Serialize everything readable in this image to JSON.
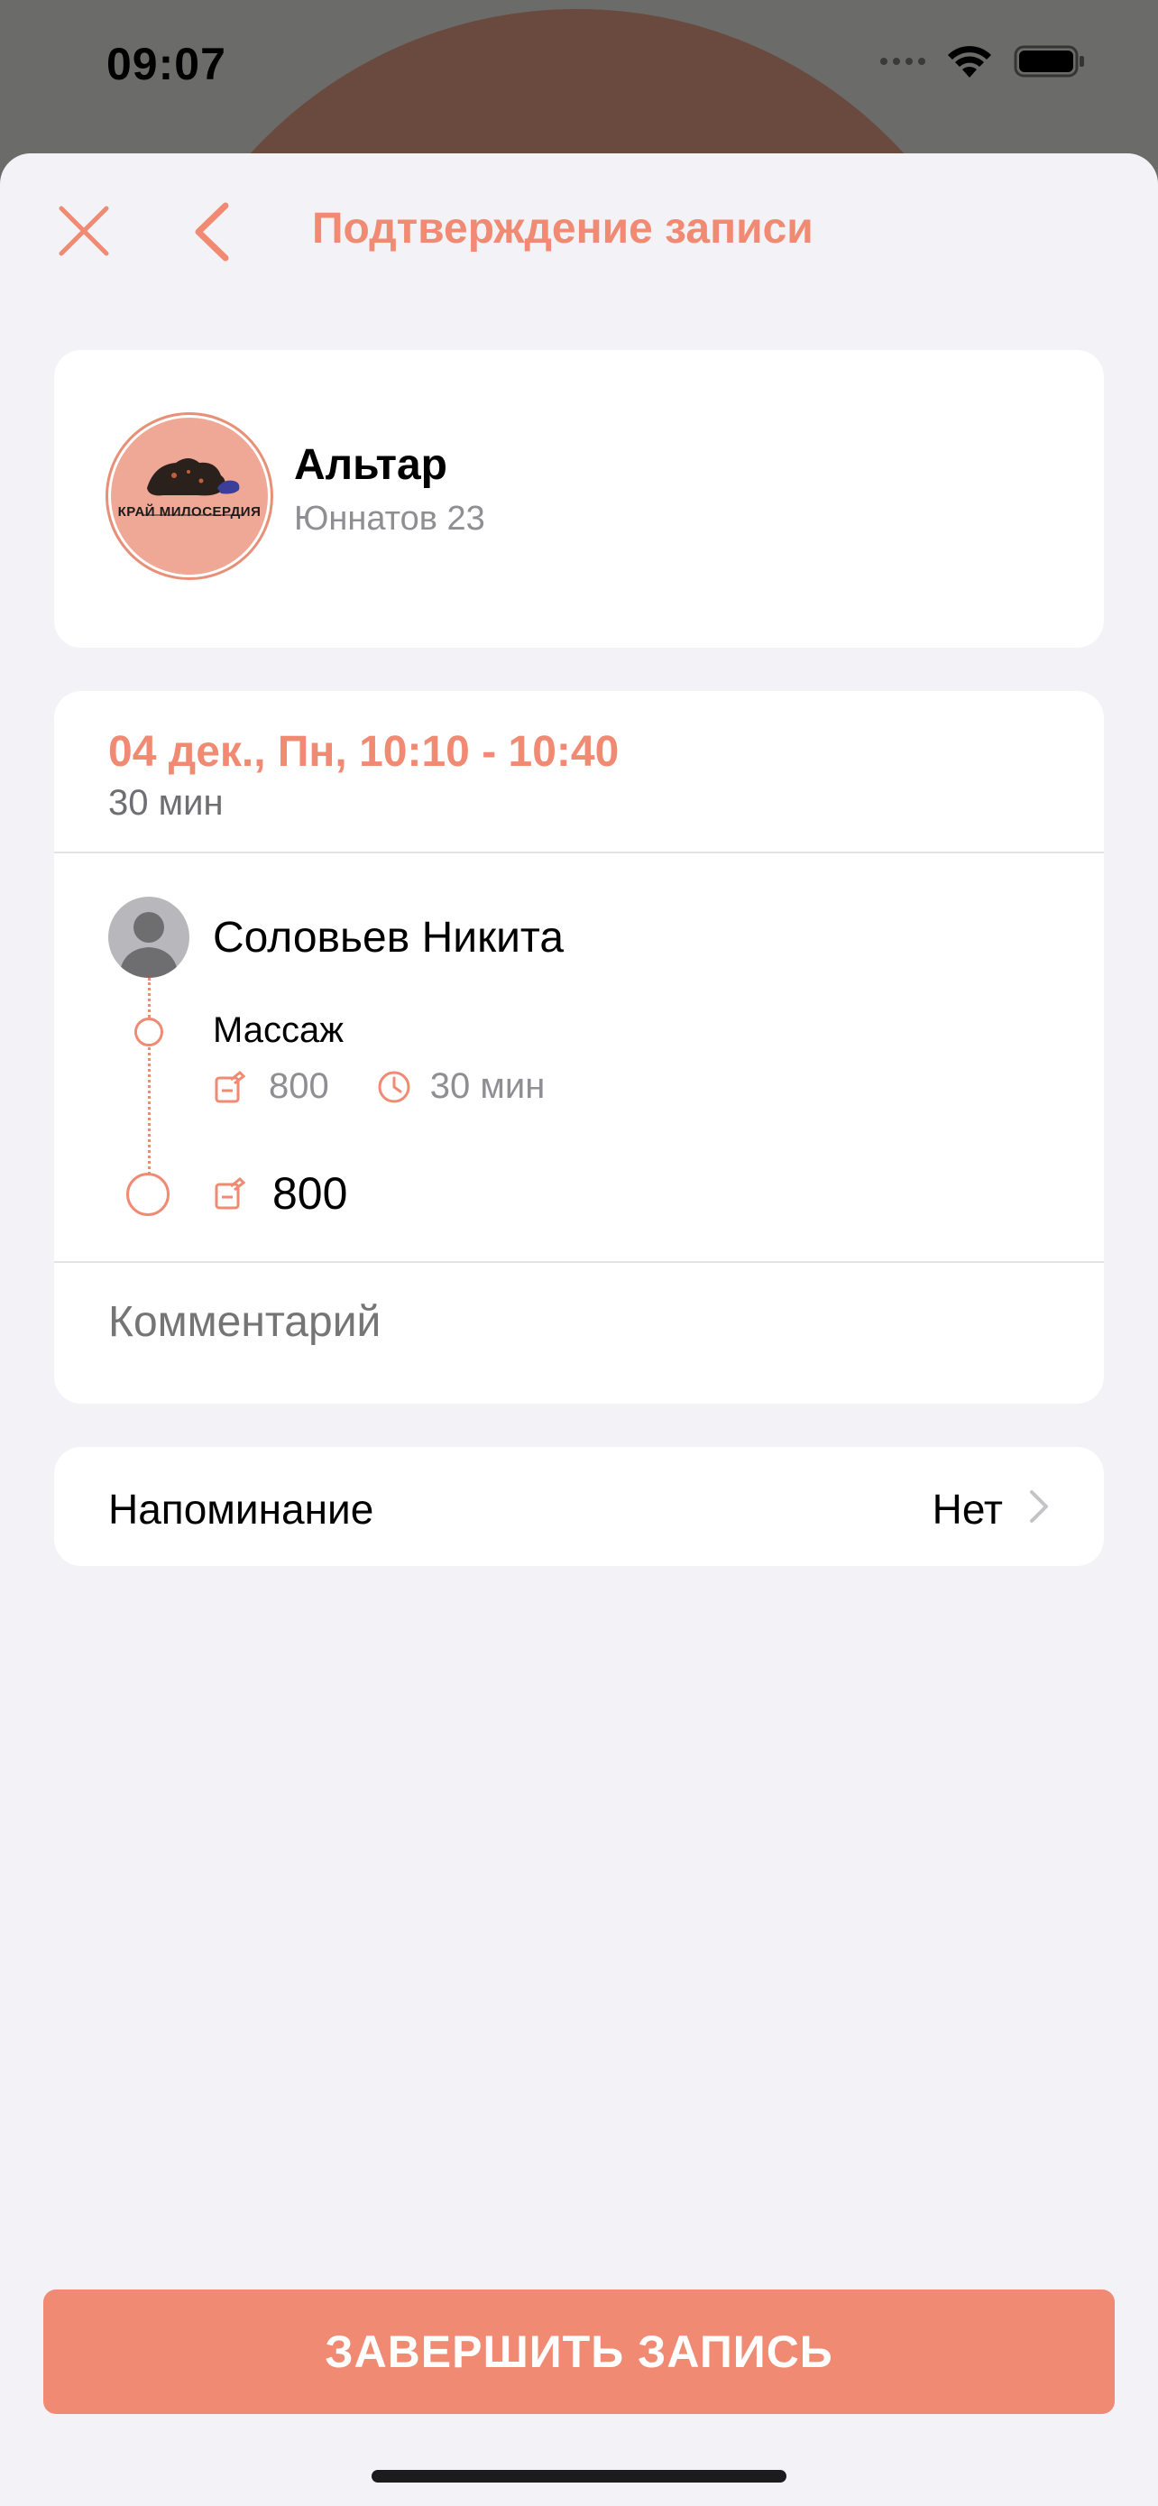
{
  "status_bar": {
    "time": "09:07"
  },
  "nav": {
    "title": "Подтверждение записи"
  },
  "venue": {
    "name": "Альтар",
    "address": "Юннатов 23",
    "logo_text": "КРАЙ МИЛОСЕРДИЯ"
  },
  "booking": {
    "date_time": "04 дек., Пн, 10:10 - 10:40",
    "duration": "30 мин",
    "staff_name": "Соловьев Никита",
    "service": {
      "name": "Массаж",
      "price": "800",
      "duration": "30 мин"
    },
    "total": "800",
    "comment_placeholder": "Комментарий"
  },
  "reminder": {
    "label": "Напоминание",
    "value": "Нет"
  },
  "actions": {
    "finish_label": "ЗАВЕРШИТЬ ЗАПИСЬ"
  },
  "colors": {
    "accent": "#f08a72",
    "background": "#f2f2f7",
    "card": "#ffffff",
    "secondary_text": "#8e8e93"
  },
  "icons": {
    "close": "close-icon",
    "back": "chevron-left-icon",
    "price": "price-tag-icon",
    "clock": "clock-icon",
    "chevron": "chevron-right-icon"
  }
}
